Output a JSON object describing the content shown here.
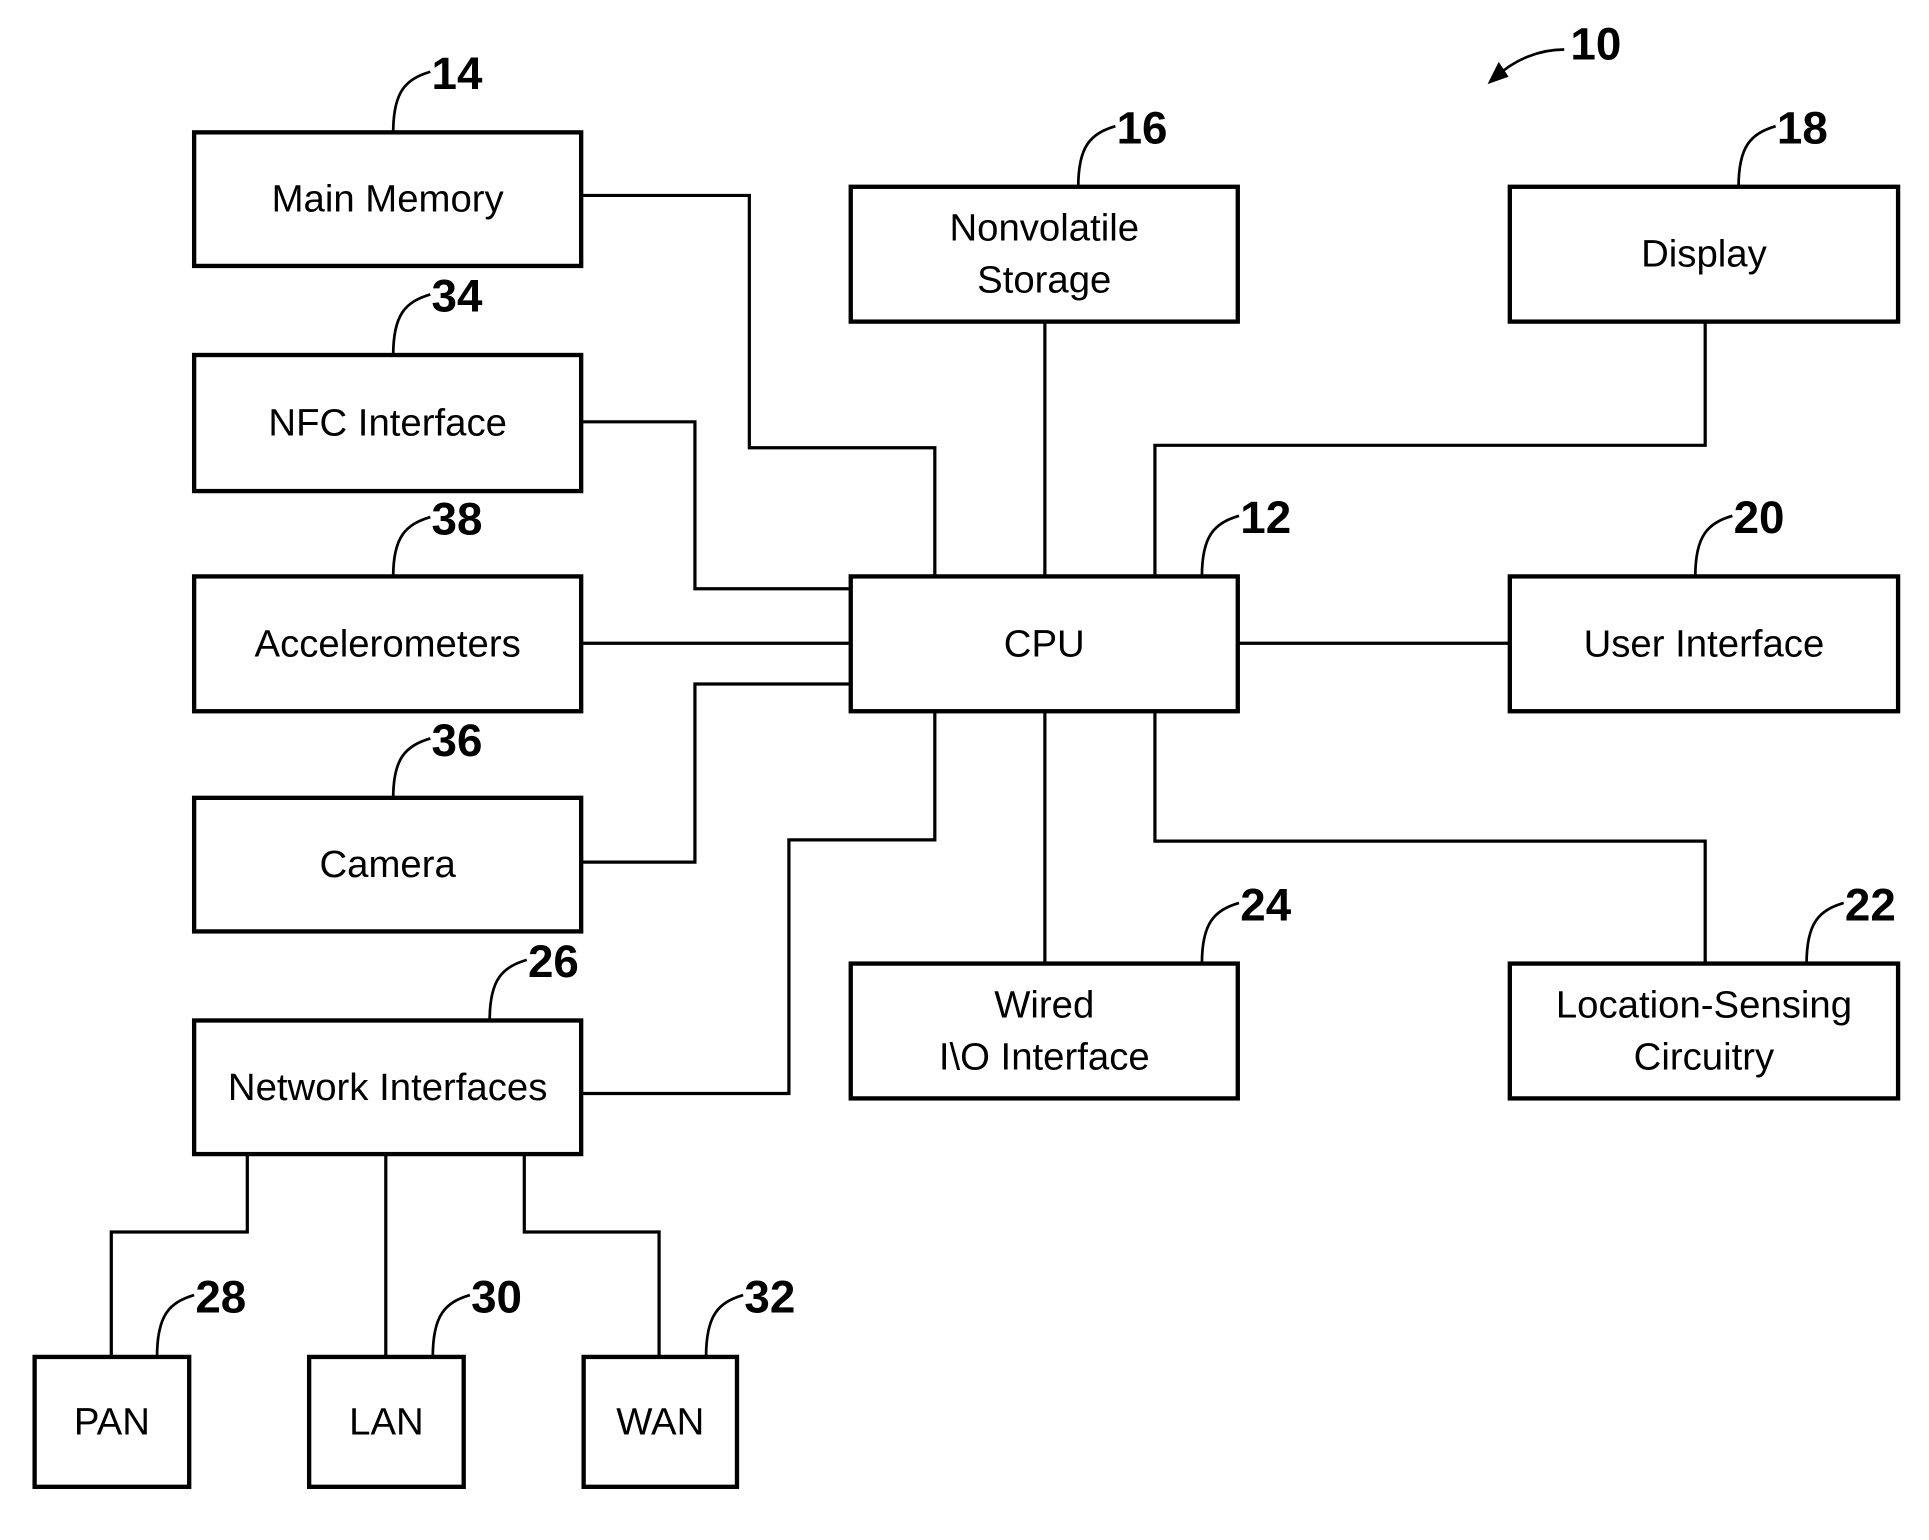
{
  "figure": {
    "ref": "10",
    "blocks": {
      "main_memory": {
        "ref": "14",
        "lines": [
          "Main Memory"
        ]
      },
      "nfc": {
        "ref": "34",
        "lines": [
          "NFC Interface"
        ]
      },
      "accel": {
        "ref": "38",
        "lines": [
          "Accelerometers"
        ]
      },
      "camera": {
        "ref": "36",
        "lines": [
          "Camera"
        ]
      },
      "network": {
        "ref": "26",
        "lines": [
          "Network Interfaces"
        ]
      },
      "pan": {
        "ref": "28",
        "lines": [
          "PAN"
        ]
      },
      "lan": {
        "ref": "30",
        "lines": [
          "LAN"
        ]
      },
      "wan": {
        "ref": "32",
        "lines": [
          "WAN"
        ]
      },
      "storage": {
        "ref": "16",
        "lines": [
          "Nonvolatile",
          "Storage"
        ]
      },
      "display": {
        "ref": "18",
        "lines": [
          "Display"
        ]
      },
      "cpu": {
        "ref": "12",
        "lines": [
          "CPU"
        ]
      },
      "ui": {
        "ref": "20",
        "lines": [
          "User Interface"
        ]
      },
      "wired": {
        "ref": "24",
        "lines": [
          "Wired",
          "I\\O Interface"
        ]
      },
      "location": {
        "ref": "22",
        "lines": [
          "Location-Sensing",
          "Circuitry"
        ]
      }
    },
    "connections": [
      [
        "main_memory",
        "cpu"
      ],
      [
        "nfc",
        "cpu"
      ],
      [
        "accel",
        "cpu"
      ],
      [
        "camera",
        "cpu"
      ],
      [
        "network",
        "cpu"
      ],
      [
        "storage",
        "cpu"
      ],
      [
        "display",
        "cpu"
      ],
      [
        "ui",
        "cpu"
      ],
      [
        "wired",
        "cpu"
      ],
      [
        "location",
        "cpu"
      ],
      [
        "network",
        "pan"
      ],
      [
        "network",
        "lan"
      ],
      [
        "network",
        "wan"
      ]
    ]
  }
}
